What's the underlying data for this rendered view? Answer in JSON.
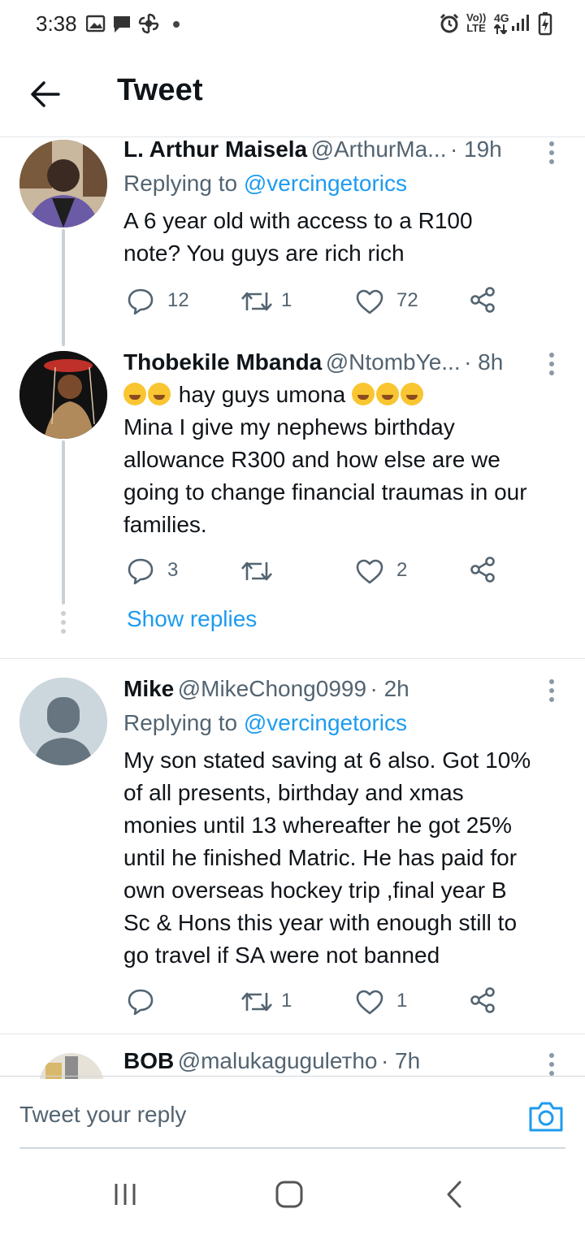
{
  "status_bar": {
    "time": "3:38",
    "network": "4G",
    "volte": "Vo)) LTE"
  },
  "header": {
    "title": "Tweet"
  },
  "tweets": [
    {
      "name": "L. Arthur Maisela",
      "handle": "@ArthurMa...",
      "time": "· 19h",
      "replying_prefix": "Replying to ",
      "replying_handle": "@vercingetorics",
      "lines": [
        "A 6 year old with access to a R100",
        "note? You guys are rich rich"
      ],
      "replies": "12",
      "retweets": "1",
      "likes": "72"
    },
    {
      "name": "Thobekile Mbanda",
      "handle": "@NtombYe...",
      "time": "· 8h",
      "emoji_text": "hay guys umona",
      "lines": [
        "Mina I give my nephews birthday",
        "allowance R300 and how else are we",
        "going to change financial traumas in our",
        "families."
      ],
      "replies": "3",
      "retweets": "",
      "likes": "2"
    },
    {
      "name": "Mike",
      "handle": "@MikeChong0999",
      "time": "· 2h",
      "replying_prefix": "Replying to ",
      "replying_handle": "@vercingetorics",
      "lines": [
        "My son stated saving at 6 also. Got 10%",
        "of all presents, birthday and xmas",
        "monies until 13 whereafter he got 25%",
        "until he finished Matric. He has paid for",
        "own overseas hockey trip ,final year B",
        "Sc & Hons this year with enough still to",
        "go travel if SA were not banned"
      ],
      "replies": "",
      "retweets": "1",
      "likes": "1"
    },
    {
      "name": "BOB",
      "handle": "@malukagugulетho",
      "time": "· 7h"
    }
  ],
  "show_replies": "Show replies",
  "compose": {
    "placeholder": "Tweet your reply"
  },
  "colors": {
    "accent": "#1d9bf0",
    "text": "#0f1419",
    "secondary": "#536471"
  }
}
